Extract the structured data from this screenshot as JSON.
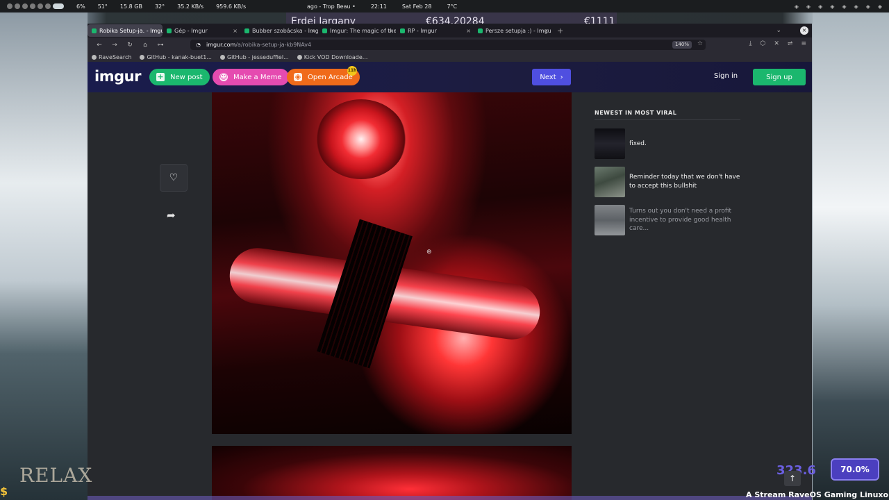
{
  "panel": {
    "cpu": "6%",
    "temp": "51°",
    "ram": "15.8 GB",
    "gpu_temp": "32°",
    "net_down": "35.2 KB/s",
    "net_up": "959.6 KB/s",
    "music": "ago - Trop Beau •",
    "time": "22:11",
    "date": "Sat Feb 28",
    "weather": "7°C"
  },
  "ticker": {
    "name": "Erdei Jargany",
    "amount1": "€634.20284",
    "amount2": "€1111"
  },
  "tabs": [
    {
      "label": "Robika Setup-ja. - Imgur",
      "active": true
    },
    {
      "label": "Gép - Imgur",
      "active": false
    },
    {
      "label": "Bubber szobácska - Img",
      "active": false
    },
    {
      "label": "Imgur: The magic of the",
      "active": false
    },
    {
      "label": "RP - Imgur",
      "active": false
    },
    {
      "label": "Persze setupja :) - Imgu",
      "active": false
    }
  ],
  "address": {
    "host": "imgur.com",
    "path": "/a/robika-setup-ja-kb9NAv4",
    "zoom": "140%"
  },
  "bookmarks": [
    "RaveSearch",
    "GitHub - kanak-buet1...",
    "GitHub - jesseduffiel...",
    "Kick VOD Downloade..."
  ],
  "imgur": {
    "logo": "imgur",
    "new_post": "New post",
    "make_meme": "Make a Meme",
    "open_arcade": "Open Arcade",
    "arcade_badge": "11h",
    "next": "Next",
    "sign_in": "Sign in",
    "sign_up": "Sign up"
  },
  "sidebar": {
    "title": "NEWEST IN MOST VIRAL",
    "items": [
      {
        "title": "fixed."
      },
      {
        "title": "Reminder today that we don't have to accept this bullshit"
      },
      {
        "title": "Turns out you don't need a profit incentive to provide good health care..."
      }
    ]
  },
  "overlay": {
    "kbps": "323.6",
    "percent": "70.0%",
    "relax": "RELAX",
    "stream": "A Stream RaveOS Gaming Linuxon fut"
  },
  "colors": {
    "imgur_green": "#1bb76e",
    "imgur_pink": "#e54bb0",
    "imgur_orange": "#f06a1a",
    "next_blue": "#4f4fe0"
  }
}
